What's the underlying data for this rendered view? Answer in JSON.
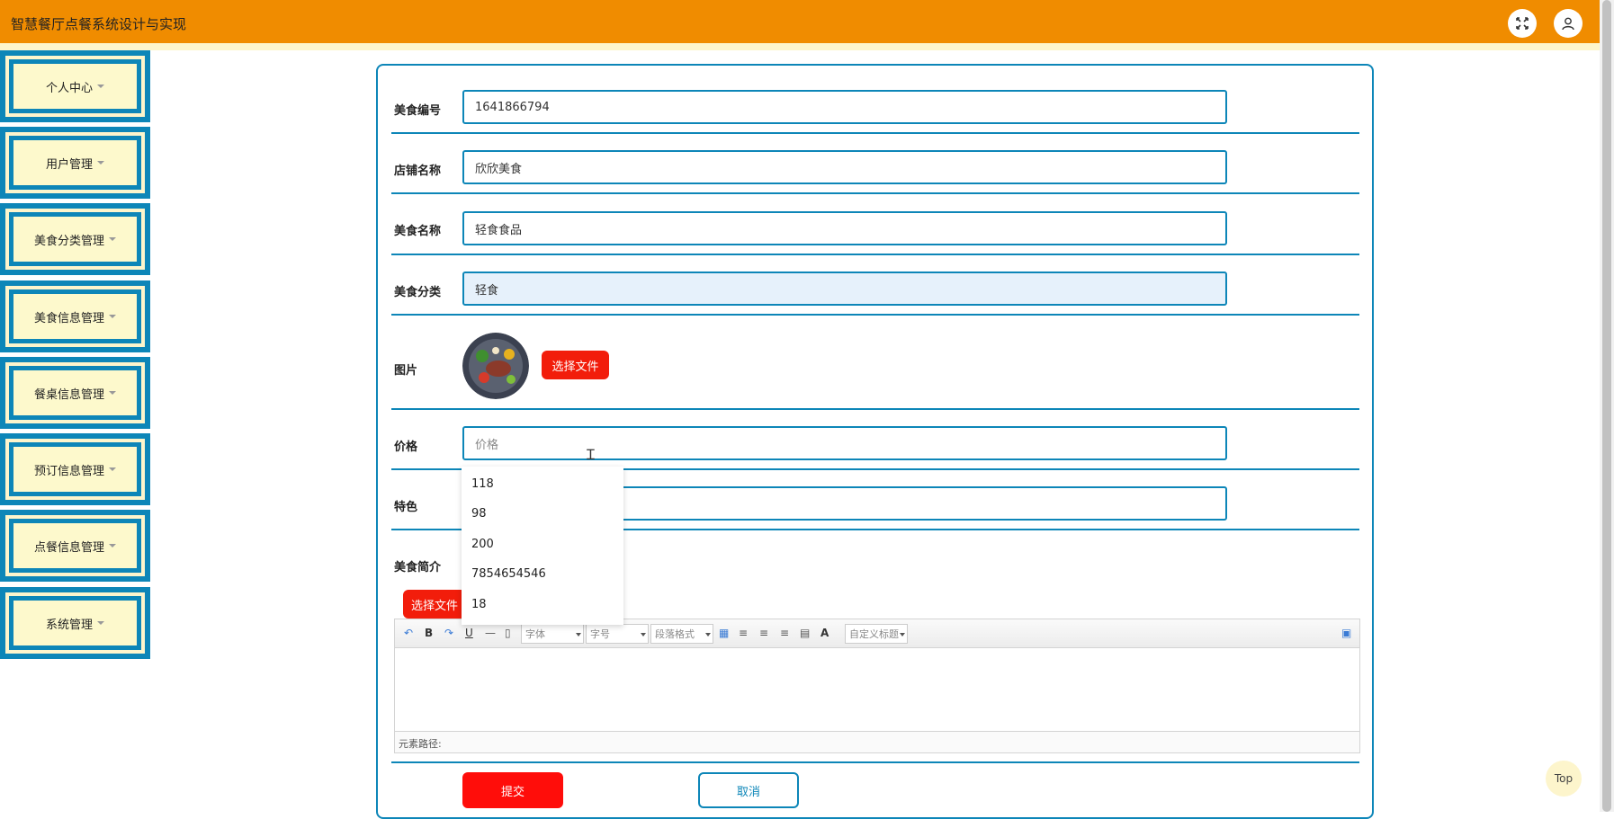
{
  "app": {
    "title": "智慧餐厅点餐系统设计与实现"
  },
  "sidebar": {
    "items": [
      {
        "label": "个人中心"
      },
      {
        "label": "用户管理"
      },
      {
        "label": "美食分类管理"
      },
      {
        "label": "美食信息管理"
      },
      {
        "label": "餐桌信息管理"
      },
      {
        "label": "预订信息管理"
      },
      {
        "label": "点餐信息管理"
      },
      {
        "label": "系统管理"
      }
    ]
  },
  "form": {
    "food_id": {
      "label": "美食编号",
      "value": "1641866794"
    },
    "shop_name": {
      "label": "店铺名称",
      "value": "欣欣美食"
    },
    "food_name": {
      "label": "美食名称",
      "value": "轻食食品"
    },
    "category": {
      "label": "美食分类",
      "value": "轻食"
    },
    "image": {
      "label": "图片",
      "button": "选择文件"
    },
    "price": {
      "label": "价格",
      "placeholder": "价格",
      "value": ""
    },
    "feature": {
      "label": "特色",
      "value": ""
    },
    "intro": {
      "label": "美食简介",
      "button": "选择文件"
    }
  },
  "autocomplete": {
    "options": [
      "118",
      "98",
      "200",
      "7854654546",
      "18"
    ]
  },
  "editor": {
    "font_family": "字体",
    "font_size": "字号",
    "paragraph": "段落格式",
    "custom_title": "自定义标题",
    "footer": "元素路径:"
  },
  "actions": {
    "submit": "提交",
    "cancel": "取消",
    "top": "Top"
  },
  "colors": {
    "header": "#f08c00",
    "accent": "#0d86b8",
    "danger": "#f21d0b",
    "cream": "#fdf5cc"
  }
}
